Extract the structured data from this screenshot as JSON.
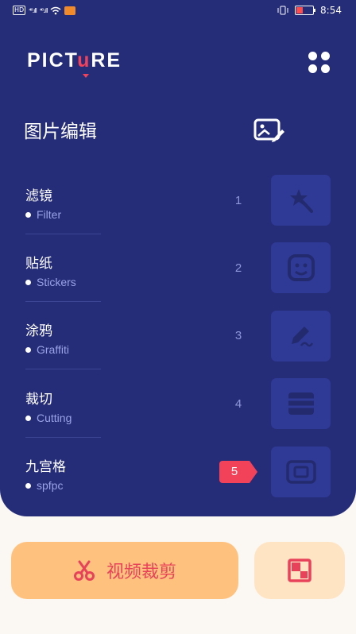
{
  "status_bar": {
    "hd_tag": "HD",
    "signal1": "⁴⁶.ıll",
    "signal2": "⁴⁶.ıll",
    "time": "8:54"
  },
  "logo": {
    "part1": "PICT",
    "accent": "u",
    "part2": "RE"
  },
  "section_title": "图片编辑",
  "items": [
    {
      "zh": "滤镜",
      "en": "Filter",
      "num": "1"
    },
    {
      "zh": "贴纸",
      "en": "Stickers",
      "num": "2"
    },
    {
      "zh": "涂鸦",
      "en": "Graffiti",
      "num": "3"
    },
    {
      "zh": "裁切",
      "en": "Cutting",
      "num": "4"
    },
    {
      "zh": "九宫格",
      "en": "spfpc",
      "num": "5"
    }
  ],
  "active_item": "5",
  "bottom": {
    "video_label": "视频裁剪"
  },
  "colors": {
    "panel": "#262d78",
    "accent": "#f2425a",
    "tile": "#2f3a97",
    "video_button": "#ffc27e"
  },
  "icons": [
    "grid-menu-icon",
    "image-edit-icon",
    "star-wand-icon",
    "sticker-face-icon",
    "pencil-icon",
    "stack-icon",
    "frame-icon",
    "scissors-icon",
    "collage-icon"
  ]
}
